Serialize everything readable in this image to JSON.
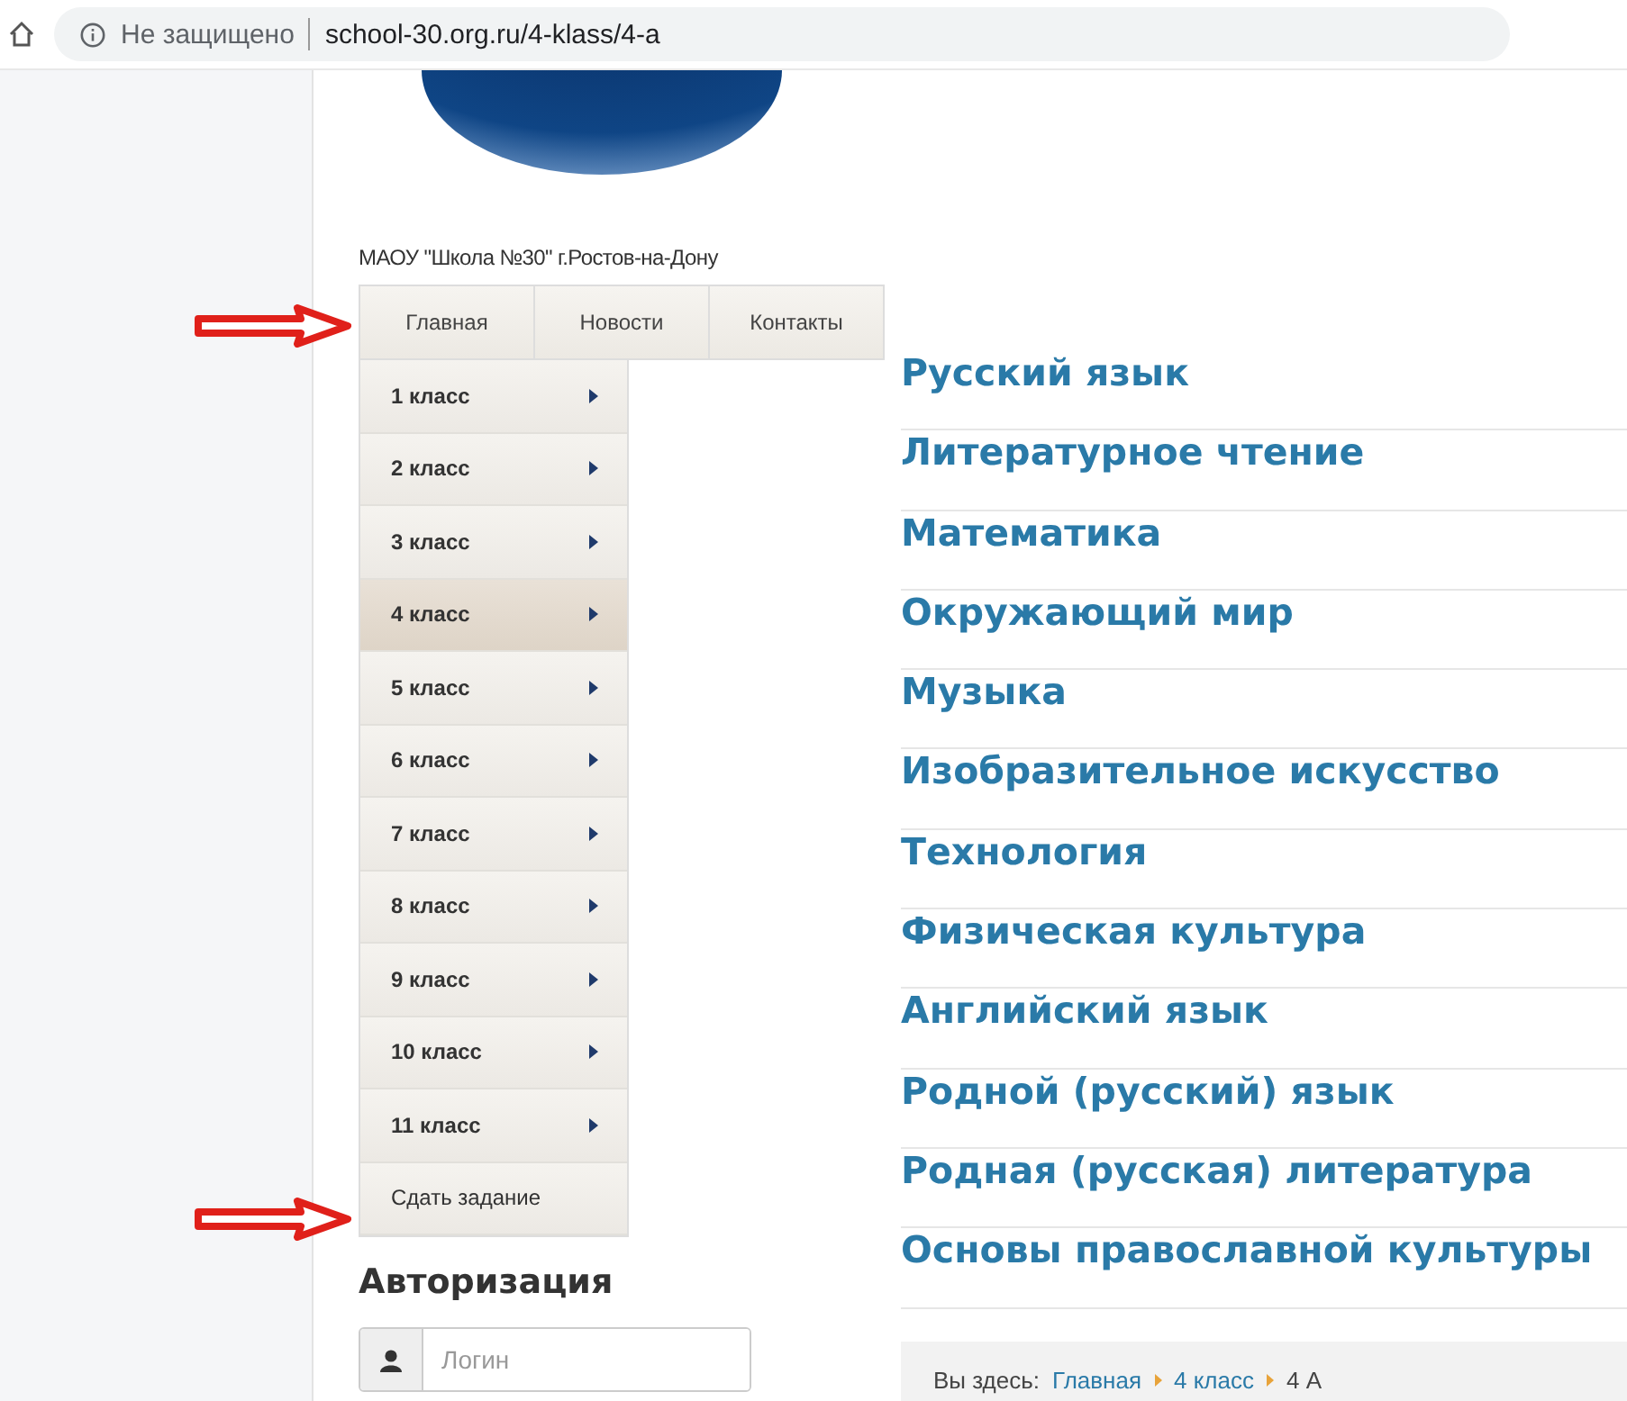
{
  "browser": {
    "security": "Не защищено",
    "url": "school-30.org.ru/4-klass/4-a"
  },
  "site_title": "МАОУ \"Школа №30\" г.Ростов-на-Дону",
  "top_nav": [
    "Главная",
    "Новости",
    "Контакты"
  ],
  "menu": [
    {
      "label": "1 класс",
      "has_submenu": true,
      "selected": false
    },
    {
      "label": "2 класс",
      "has_submenu": true,
      "selected": false
    },
    {
      "label": "3 класс",
      "has_submenu": true,
      "selected": false
    },
    {
      "label": "4 класс",
      "has_submenu": true,
      "selected": true
    },
    {
      "label": "5 класс",
      "has_submenu": true,
      "selected": false
    },
    {
      "label": "6 класс",
      "has_submenu": true,
      "selected": false
    },
    {
      "label": "7 класс",
      "has_submenu": true,
      "selected": false
    },
    {
      "label": "8 класс",
      "has_submenu": true,
      "selected": false
    },
    {
      "label": "9 класс",
      "has_submenu": true,
      "selected": false
    },
    {
      "label": "10 класс",
      "has_submenu": true,
      "selected": false
    },
    {
      "label": "11 класс",
      "has_submenu": true,
      "selected": false
    },
    {
      "label": "Сдать задание",
      "has_submenu": false,
      "selected": false
    }
  ],
  "login": {
    "heading": "Авторизация",
    "placeholder": "Логин"
  },
  "subjects": [
    "Русский язык",
    "Литературное чтение",
    "Математика",
    "Окружающий мир",
    "Музыка",
    "Изобразительное искусство",
    "Технология",
    "Физическая культура",
    "Английский язык",
    "Родной (русский) язык",
    "Родная (русская) литература",
    "Основы православной культуры"
  ],
  "breadcrumb": {
    "label": "Вы здесь:",
    "links": [
      "Главная",
      "4 класс"
    ],
    "current": "4 А"
  },
  "annotations": [
    {
      "kind": "arrow"
    },
    {
      "kind": "arrow"
    }
  ]
}
